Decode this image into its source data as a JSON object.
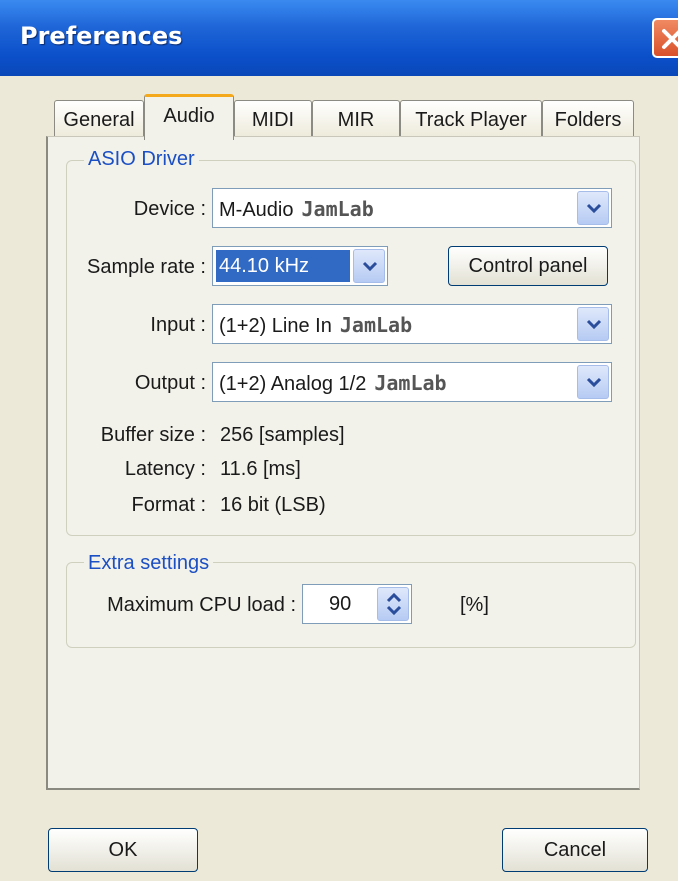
{
  "window": {
    "title": "Preferences"
  },
  "tabs": [
    "General",
    "Audio",
    "MIDI",
    "MIR",
    "Track Player",
    "Folders"
  ],
  "active_tab": "Audio",
  "asio": {
    "title": "ASIO Driver",
    "device_label": "Device :",
    "device_value": "M-Audio",
    "device_brand": "JamLab",
    "sample_rate_label": "Sample rate :",
    "sample_rate_value": "44.10 kHz",
    "control_panel_label": "Control panel",
    "input_label": "Input :",
    "input_value": "(1+2) Line In",
    "input_brand": "JamLab",
    "output_label": "Output :",
    "output_value": "(1+2) Analog 1/2",
    "output_brand": "JamLab",
    "buffer_label": "Buffer size :",
    "buffer_value": "256 [samples]",
    "latency_label": "Latency :",
    "latency_value": "11.6 [ms]",
    "format_label": "Format :",
    "format_value": "16 bit (LSB)"
  },
  "extra": {
    "title": "Extra settings",
    "cpu_label": "Maximum CPU load :",
    "cpu_value": "90",
    "cpu_unit": "[%]"
  },
  "buttons": {
    "ok": "OK",
    "cancel": "Cancel"
  },
  "colors": {
    "title_bar": "#0b4fc9",
    "selection": "#316ac5",
    "group_title": "#1b4fc4",
    "active_tab_accent": "#f4a81c"
  }
}
